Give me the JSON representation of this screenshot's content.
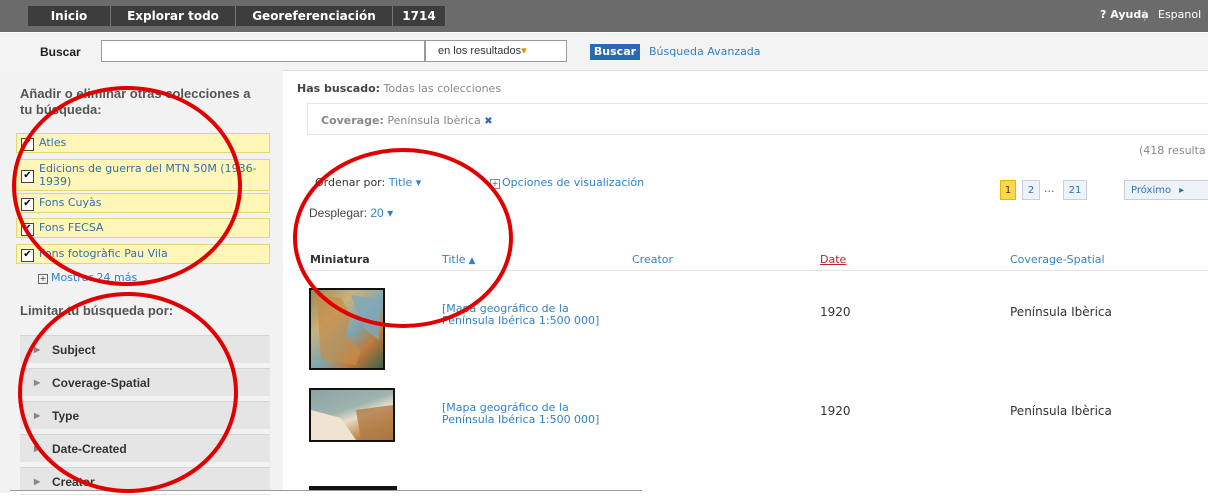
{
  "nav": {
    "tabs": [
      "Inicio",
      "Explorar todo",
      "Georeferenciación",
      "1714"
    ],
    "help": "? Ayuda",
    "separator": "|",
    "language": "Espanol"
  },
  "search": {
    "label": "Buscar",
    "query": "",
    "scope": "en los resultados",
    "button": "Buscar",
    "advanced": "Búsqueda Avanzada"
  },
  "sidebar": {
    "collections_heading": "Añadir o eliminar otras colecciones a tu búsqueda:",
    "collections": [
      {
        "label": "Atles",
        "checked": true
      },
      {
        "label": "Edicions de guerra del MTN 50M (1936-1939)",
        "checked": true
      },
      {
        "label": "Fons Cuyàs",
        "checked": true
      },
      {
        "label": "Fons FECSA",
        "checked": true
      },
      {
        "label": "Fons fotogràfic Pau Vila",
        "checked": true
      }
    ],
    "show_more": "Mostrar 24 más",
    "limit_heading": "Limitar tu búsqueda por:",
    "facets": [
      "Subject",
      "Coverage-Spatial",
      "Type",
      "Date-Created",
      "Creator"
    ]
  },
  "results": {
    "searched_label": "Has buscado:",
    "searched_value": "Todas las colecciones",
    "filter_label": "Coverage:",
    "filter_value": "Península Ibèrica",
    "filter_remove": "✖",
    "count": "(418 resulta",
    "sort_label": "Ordenar por:",
    "sort_value": "Title",
    "view_options": "Opciones de visualización",
    "display_label": "Desplegar:",
    "display_value": "20",
    "pages": [
      "1",
      "2",
      "...",
      "21"
    ],
    "next": "Próximo",
    "columns": [
      "Miniatura",
      "Title",
      "Creator",
      "Date",
      "Coverage-Spatial"
    ],
    "rows": [
      {
        "title": "[Mapa geográfico de la Península Ibérica 1:500 000]",
        "creator": "",
        "date": "1920",
        "coverage": "Península Ibèrica"
      },
      {
        "title": "[Mapa geográfico de la Península Ibérica 1:500 000]",
        "creator": "",
        "date": "1920",
        "coverage": "Península Ibèrica"
      }
    ]
  },
  "colors": {
    "accent": "#2d68b1",
    "link": "#2f82c8",
    "highlight": "#fff6b8",
    "annotation": "#e00000"
  }
}
